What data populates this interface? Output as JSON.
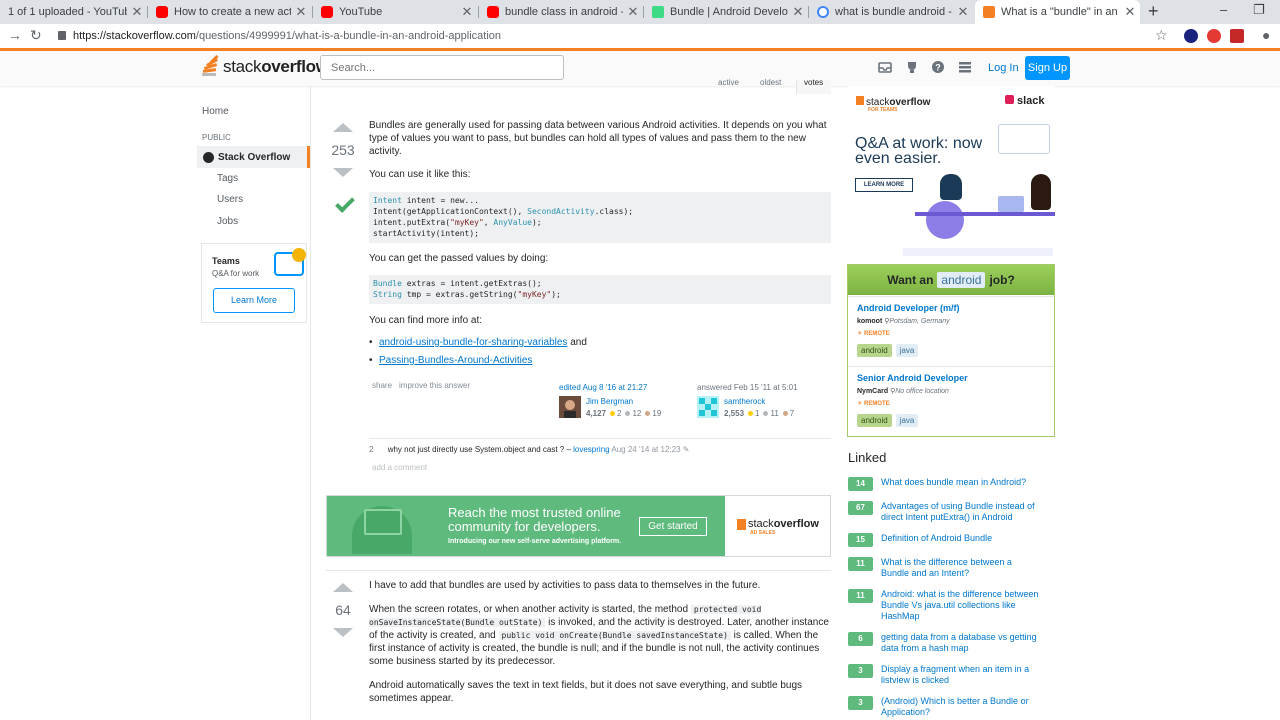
{
  "browser": {
    "tabs": [
      {
        "title": "1 of 1 uploaded - YouTube",
        "icon": "none"
      },
      {
        "title": "How to create a new activity and",
        "icon": "youtube-icon"
      },
      {
        "title": "YouTube",
        "icon": "youtube-icon"
      },
      {
        "title": "bundle class in android - YouTub",
        "icon": "youtube-icon"
      },
      {
        "title": "Bundle  |  Android Developers",
        "icon": "android-icon"
      },
      {
        "title": "what is bundle android - Google",
        "icon": "google-icon"
      },
      {
        "title": "What is a \"bundle\" in an Android",
        "icon": "stackoverflow-icon"
      }
    ],
    "url_host": "https://stackoverflow.com",
    "url_path": "/questions/4999991/what-is-a-bundle-in-an-android-application"
  },
  "topbar": {
    "logo_light": "stack",
    "logo_bold": "overflow",
    "search_placeholder": "Search...",
    "login": "Log In",
    "signup": "Sign Up"
  },
  "leftnav": {
    "home": "Home",
    "public": "PUBLIC",
    "stackoverflow": "Stack Overflow",
    "tags": "Tags",
    "users": "Users",
    "jobs": "Jobs",
    "teams_title": "Teams",
    "teams_sub": "Q&A for work",
    "learn_more": "Learn More"
  },
  "sort_tabs": {
    "active": "active",
    "oldest": "oldest",
    "votes": "votes"
  },
  "answer1": {
    "votes": "253",
    "p1": "Bundles are generally used for passing data between various Android activities. It depends on you what type of values you want to pass, but bundles can hold all types of values and pass them to the new activity.",
    "p2": "You can use it like this:",
    "code1": [
      {
        "t": "Intent",
        "rest": " intent = new..."
      },
      {
        "t": "",
        "rest": "Intent(getApplicationContext(), ",
        "t2": "SecondActivity",
        "rest2": ".class);"
      },
      {
        "t": "",
        "rest": "intent.putExtra(",
        "s": "\"myKey\"",
        "rest2": ", ",
        "t2": "AnyValue",
        "rest3": ");"
      },
      {
        "t": "",
        "rest": "startActivity(intent);"
      }
    ],
    "p3": "You can get the passed values by doing:",
    "code2_line1_type": "Bundle",
    "code2_line1_rest": " extras = intent.getExtras();",
    "code2_line2_type": "String",
    "code2_line2_rest": " tmp = extras.getString(",
    "code2_line2_str": "\"myKey\"",
    "code2_line2_end": ");",
    "p4": "You can find more info at:",
    "link1": "android-using-bundle-for-sharing-variables",
    "link1_after": "and",
    "link2": "Passing-Bundles-Around-Activities",
    "share": "share",
    "improve": "improve this answer",
    "edited": "edited Aug 8 '16 at 21:27",
    "editor_name": "Jim Bergman",
    "editor_rep": "4,127",
    "editor_gold": "2",
    "editor_silver": "12",
    "editor_bronze": "19",
    "answered": "answered Feb 15 '11 at 5:01",
    "author_name": "samtherock",
    "author_rep": "2,553",
    "author_gold": "1",
    "author_silver": "11",
    "author_bronze": "7",
    "comment_score": "2",
    "comment_text": "why not just directly use System.object and cast ? –",
    "comment_user": "lovespring",
    "comment_date": "Aug 24 '14 at 12:23",
    "add_comment": "add a comment"
  },
  "ad": {
    "headline": "Reach the most trusted online community for developers.",
    "sub": "Introducing our new self-serve advertising platform.",
    "button": "Get started",
    "logo_light": "stack",
    "logo_bold": "overflow",
    "logo_sub": "AD SALES"
  },
  "answer2": {
    "votes": "64",
    "p1": "I have to add that bundles are used by activities to pass data to themselves in the future.",
    "p2a": "When the screen rotates, or when another activity is started, the method",
    "p2code1": "protected void onSaveInstanceState(Bundle outState)",
    "p2b": "is invoked, and the activity is destroyed. Later, another instance of the activity is created, and",
    "p2code2": "public void onCreate(Bundle savedInstanceState)",
    "p2c": "is called. When the first instance of activity is created, the bundle is null; and if the bundle is not null, the activity continues some business started by its predecessor.",
    "p3": "Android automatically saves the text in text fields, but it does not save everything, and subtle bugs sometimes appear."
  },
  "teams_ad": {
    "logo_light": "stack",
    "logo_bold": "overflow",
    "for_teams": "FOR TEAMS",
    "slack": "slack",
    "headline": "Q&A at work: now even easier.",
    "learn_more": "LEARN MORE"
  },
  "jobs": {
    "want_prefix": "Want an",
    "want_tag": "android",
    "want_suffix": "job?",
    "items": [
      {
        "title": "Android Developer (m/f)",
        "company": "komoot",
        "location": "Potsdam, Germany",
        "remote": "REMOTE",
        "tags": [
          "android",
          "java"
        ]
      },
      {
        "title": "Senior Android Developer",
        "company": "NymCard",
        "location": "No office location",
        "remote": "REMOTE",
        "tags": [
          "android",
          "java"
        ]
      }
    ]
  },
  "linked": {
    "title": "Linked",
    "items": [
      {
        "score": "14",
        "title": "What does bundle mean in Android?"
      },
      {
        "score": "67",
        "title": "Advantages of using Bundle instead of direct Intent putExtra() in Android"
      },
      {
        "score": "15",
        "title": "Definition of Android Bundle"
      },
      {
        "score": "11",
        "title": "What is the difference between a Bundle and an Intent?"
      },
      {
        "score": "11",
        "title": "Android: what is the difference between Bundle Vs java.util collections like HashMap"
      },
      {
        "score": "6",
        "title": "getting data from a database vs getting data from a hash map"
      },
      {
        "score": "3",
        "title": "Display a fragment when an item in a listview is clicked"
      },
      {
        "score": "3",
        "title": "(Android) Which is better a Bundle or Application?"
      }
    ]
  }
}
